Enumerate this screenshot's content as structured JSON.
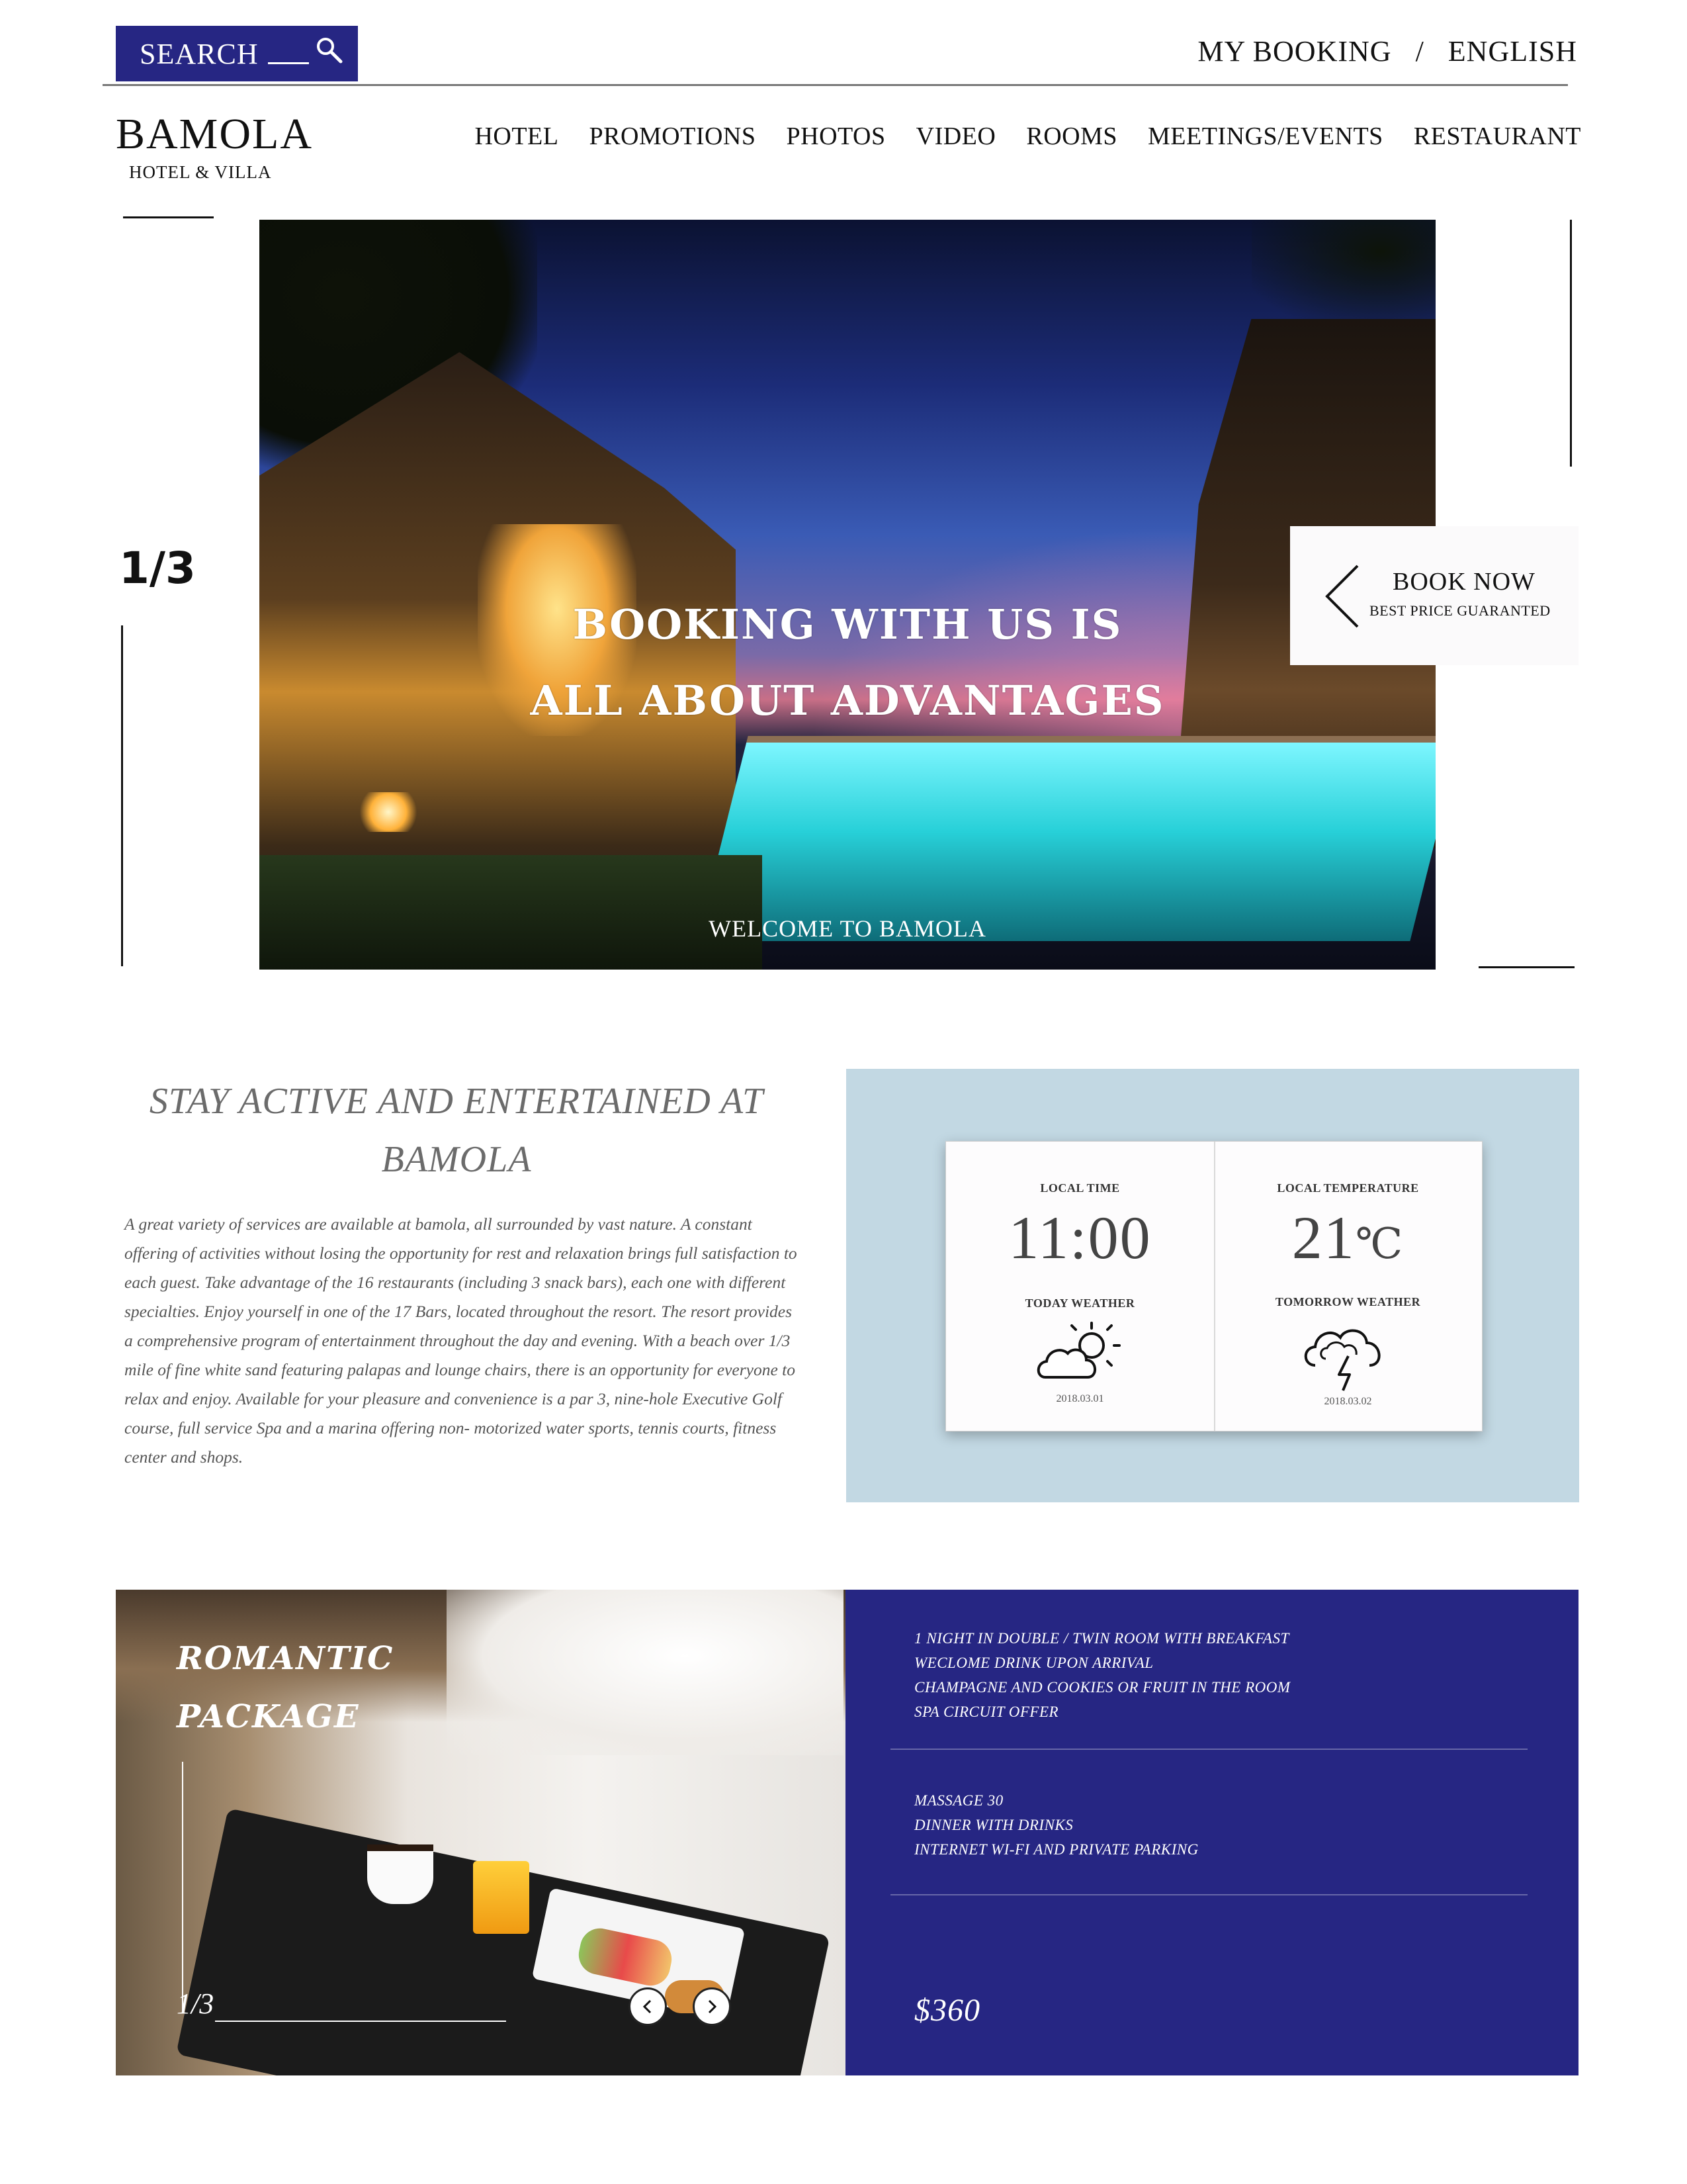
{
  "topbar": {
    "search_label": "SEARCH",
    "my_booking": "MY BOOKING",
    "separator": "/",
    "language": "ENGLISH"
  },
  "brand": {
    "name": "BAMOLA",
    "tagline": "HOTEL & VILLA"
  },
  "nav": {
    "items": [
      "HOTEL",
      "PROMOTIONS",
      "PHOTOS",
      "VIDEO",
      "ROOMS",
      "MEETINGS/EVENTS",
      "RESTAURANT"
    ]
  },
  "hero": {
    "headline_1": "BOOKING WITH US IS",
    "headline_2": "ALL ABOUT ADVANTAGES",
    "welcome": "WELCOME TO BAMOLA",
    "slide_counter": "1/3",
    "book_now": "BOOK NOW",
    "book_now_sub": "BEST PRICE GUARANTED"
  },
  "about": {
    "title": "STAY ACTIVE AND ENTERTAINED AT BAMOLA",
    "body": "A great variety of services are available at bamola, all surrounded by vast nature. A constant offering of activities without losing the opportunity for rest and relaxation brings full satisfaction to each guest. Take advantage of the 16 restaurants (including 3 snack bars), each one with different specialties. Enjoy yourself in one of the 17 Bars, located throughout the resort. The resort provides a comprehensive program of entertainment throughout the day and evening. With a beach over 1/3 mile of fine white sand featuring palapas and lounge chairs, there is an opportunity for everyone to relax and enjoy. Available for your pleasure and convenience is a par 3, nine-hole Executive Golf course, full service Spa and a marina offering non- motorized water sports, tennis courts, fitness center and shops."
  },
  "weather": {
    "local_time_label": "LOCAL TIME",
    "local_time": "11:00",
    "local_temp_label": "LOCAL TEMPERATURE",
    "local_temp": "21",
    "temp_unit": "℃",
    "today_label": "TODAY WEATHER",
    "today_date": "2018.03.01",
    "today_icon": "partly-sunny-icon",
    "tomorrow_label": "TOMORROW WEATHER",
    "tomorrow_date": "2018.03.02",
    "tomorrow_icon": "thunderstorm-icon"
  },
  "package": {
    "title_1": "ROMANTIC",
    "title_2": "PACKAGE",
    "counter": "1/3",
    "items_1": [
      "1 NIGHT IN DOUBLE / TWIN ROOM WITH BREAKFAST",
      "WECLOME DRINK UPON ARRIVAL",
      "CHAMPAGNE AND COOKIES OR FRUIT IN THE ROOM",
      "SPA CIRCUIT OFFER"
    ],
    "items_2": [
      "MASSAGE 30",
      "DINNER WITH DRINKS",
      "INTERNET WI-FI AND PRIVATE PARKING"
    ],
    "price": "$360"
  },
  "colors": {
    "brand_blue": "#262683",
    "panel_blue": "#c2d8e3"
  }
}
